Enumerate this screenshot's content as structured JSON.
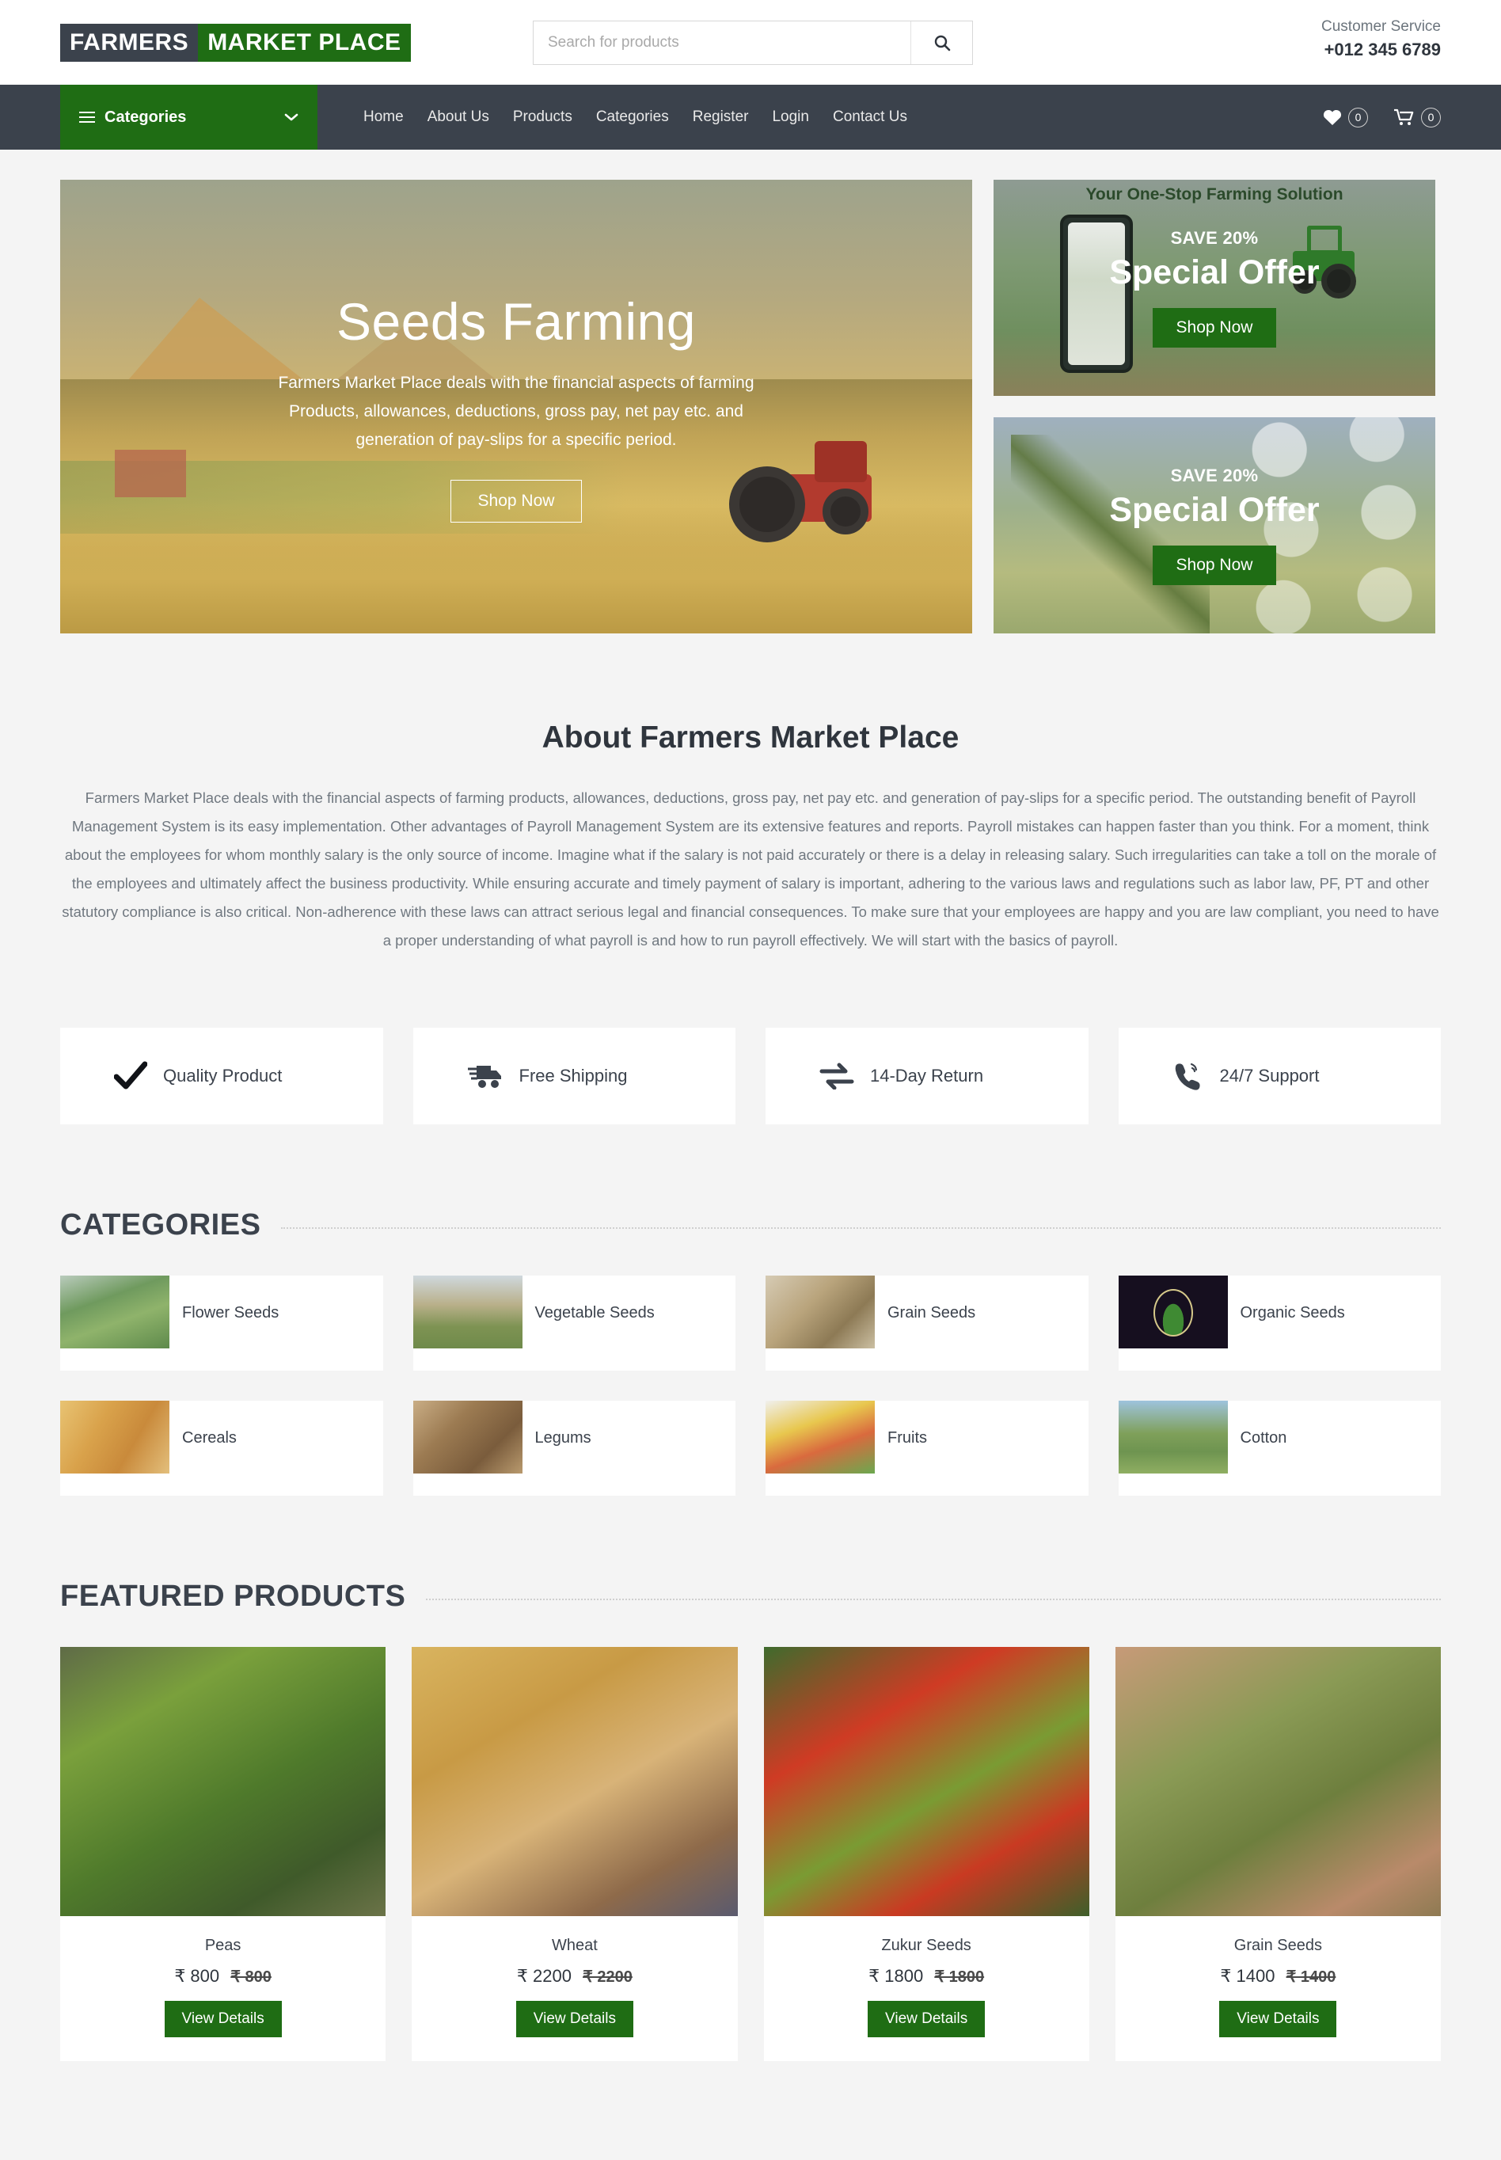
{
  "header": {
    "logo_part1": "FARMERS",
    "logo_part2": "MARKET PLACE",
    "search_placeholder": "Search for products",
    "search_value": "",
    "customer_service_label": "Customer Service",
    "customer_service_phone": "+012 345 6789"
  },
  "nav": {
    "categories_label": "Categories",
    "links": [
      {
        "label": "Home"
      },
      {
        "label": "About Us"
      },
      {
        "label": "Products"
      },
      {
        "label": "Categories"
      },
      {
        "label": "Register"
      },
      {
        "label": "Login"
      },
      {
        "label": "Contact Us"
      }
    ],
    "wishlist_count": "0",
    "cart_count": "0"
  },
  "hero": {
    "title": "Seeds Farming",
    "description": "Farmers Market Place deals with the financial aspects of farming Products, allowances, deductions, gross pay, net pay etc. and generation of pay-slips for a specific period.",
    "button": "Shop Now"
  },
  "promos": [
    {
      "top_label": "Your One-Stop Farming Solution",
      "save": "SAVE 20%",
      "title": "Special Offer",
      "button": "Shop Now"
    },
    {
      "top_label": "",
      "save": "SAVE 20%",
      "title": "Special Offer",
      "button": "Shop Now"
    }
  ],
  "about": {
    "title": "About Farmers Market Place",
    "text": "Farmers Market Place deals with the financial aspects of farming products, allowances, deductions, gross pay, net pay etc. and generation of pay-slips for a specific period. The outstanding benefit of Payroll Management System is its easy implementation. Other advantages of Payroll Management System are its extensive features and reports. Payroll mistakes can happen faster than you think. For a moment, think about the employees for whom monthly salary is the only source of income. Imagine what if the salary is not paid accurately or there is a delay in releasing salary. Such irregularities can take a toll on the morale of the employees and ultimately affect the business productivity. While ensuring accurate and timely payment of salary is important, adhering to the various laws and regulations such as labor law, PF, PT and other statutory compliance is also critical. Non-adherence with these laws can attract serious legal and financial consequences. To make sure that your employees are happy and you are law compliant, you need to have a proper understanding of what payroll is and how to run payroll effectively. We will start with the basics of payroll."
  },
  "features": [
    {
      "icon": "check-icon",
      "label": "Quality Product"
    },
    {
      "icon": "truck-icon",
      "label": "Free Shipping"
    },
    {
      "icon": "exchange-icon",
      "label": "14-Day Return"
    },
    {
      "icon": "phone-icon",
      "label": "24/7 Support"
    }
  ],
  "categories_section": {
    "title": "CATEGORIES",
    "items": [
      {
        "label": "Flower Seeds",
        "thumb": "th-flower"
      },
      {
        "label": "Vegetable Seeds",
        "thumb": "th-veg"
      },
      {
        "label": "Grain Seeds",
        "thumb": "th-grain"
      },
      {
        "label": "Organic Seeds",
        "thumb": "th-organic"
      },
      {
        "label": "Cereals",
        "thumb": "th-cereal"
      },
      {
        "label": "Legums",
        "thumb": "th-legum"
      },
      {
        "label": "Fruits",
        "thumb": "th-fruit"
      },
      {
        "label": "Cotton",
        "thumb": "th-cotton"
      }
    ]
  },
  "featured_section": {
    "title": "FEATURED PRODUCTS",
    "button_label": "View Details",
    "products": [
      {
        "name": "Peas",
        "price": "₹ 800",
        "old_price": "₹ 800",
        "img": "pi-peas"
      },
      {
        "name": "Wheat",
        "price": "₹ 2200",
        "old_price": "₹ 2200",
        "img": "pi-wheat"
      },
      {
        "name": "Zukur Seeds",
        "price": "₹ 1800",
        "old_price": "₹ 1800",
        "img": "pi-zukur"
      },
      {
        "name": "Grain Seeds",
        "price": "₹ 1400",
        "old_price": "₹ 1400",
        "img": "pi-grain"
      }
    ]
  },
  "colors": {
    "brand_green": "#1f6d14",
    "dark_slate": "#3b424c",
    "page_bg": "#f4f4f4"
  }
}
